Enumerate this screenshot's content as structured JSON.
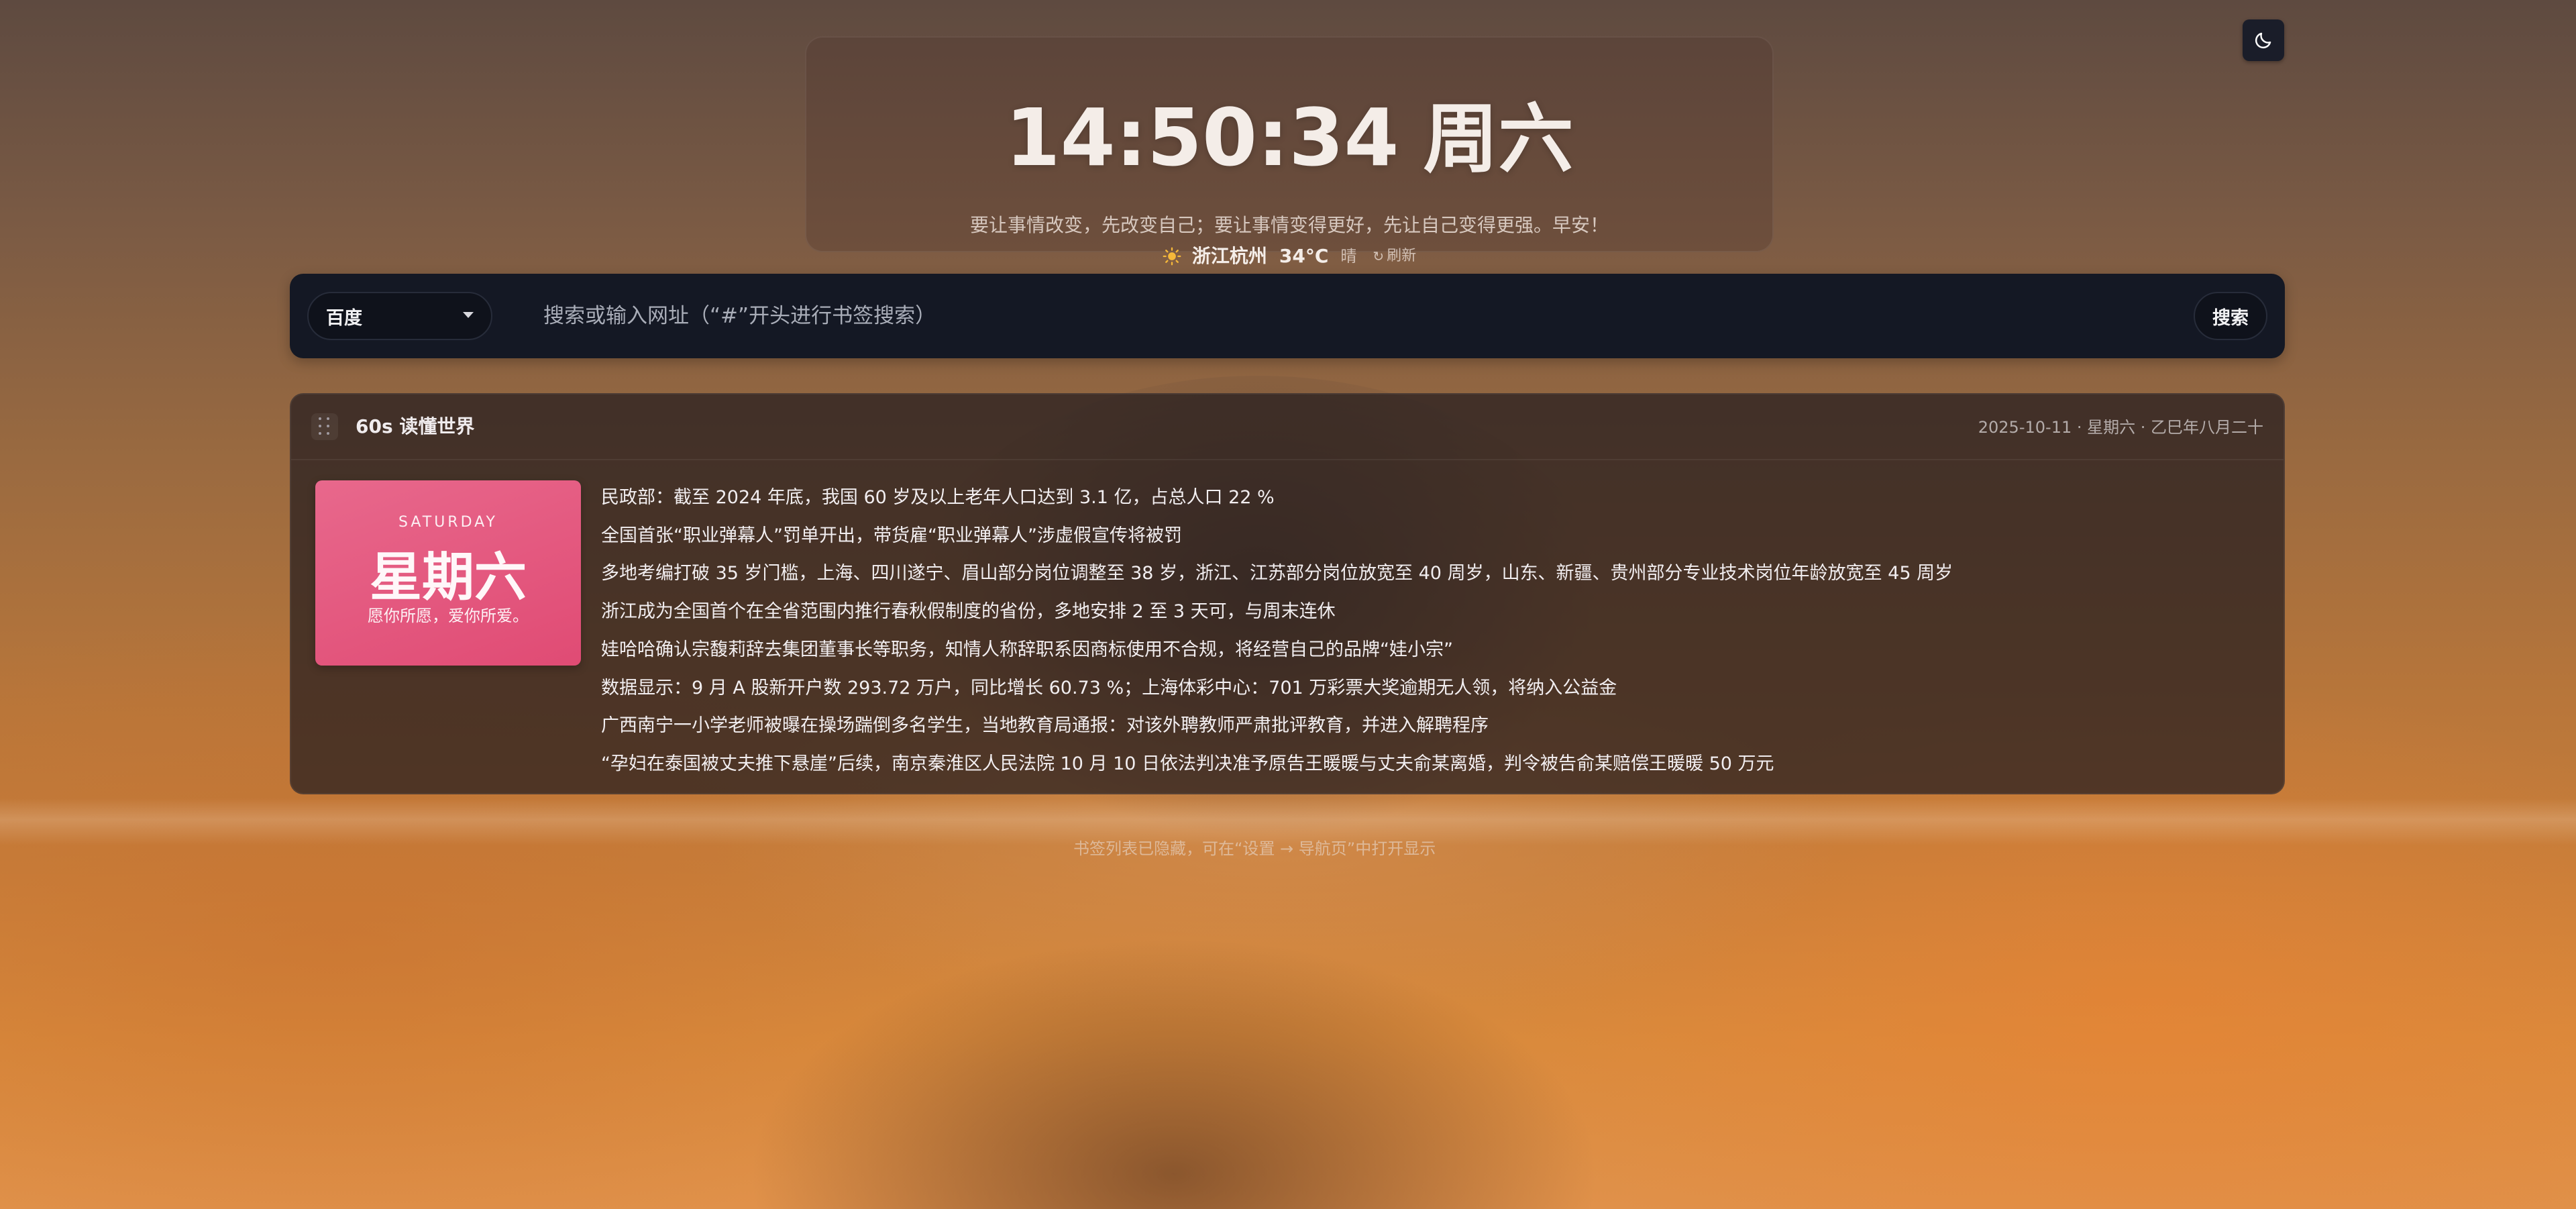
{
  "clock": {
    "time": "14:50:34",
    "weekday": "周六",
    "quote": "要让事情改变，先改变自己；要让事情变得更好，先让自己变得更强。早安！"
  },
  "weather": {
    "icon": "sun-icon",
    "city": "浙江杭州",
    "temperature": "34°C",
    "condition": "晴",
    "refresh_label": "刷新"
  },
  "search": {
    "engine": "百度",
    "placeholder": "搜索或输入网址（“#”开头进行书签搜索）",
    "button_label": "搜索"
  },
  "news_card": {
    "title": "60s 读懂世界",
    "date": "2025-10-11 · 星期六 · 乙巳年八月二十",
    "day_image": {
      "english": "SATURDAY",
      "chinese": "星期六",
      "motto": "愿你所愿，爱你所爱。"
    },
    "items": [
      "民政部：截至 2024 年底，我国 60 岁及以上老年人口达到 3.1 亿，占总人口 22 %",
      "全国首张“职业弹幕人”罚单开出，带货雇“职业弹幕人”涉虚假宣传将被罚",
      "多地考编打破 35 岁门槛，上海、四川遂宁、眉山部分岗位调整至 38 岁，浙江、江苏部分岗位放宽至 40 周岁，山东、新疆、贵州部分专业技术岗位年龄放宽至 45 周岁",
      "浙江成为全国首个在全省范围内推行春秋假制度的省份，多地安排 2 至 3 天可，与周末连休",
      "娃哈哈确认宗馥莉辞去集团董事长等职务，知情人称辞职系因商标使用不合规，将经营自己的品牌“娃小宗”",
      "数据显示：9 月 A 股新开户数 293.72 万户，同比增长 60.73 %；上海体彩中心：701 万彩票大奖逾期无人领，将纳入公益金",
      "广西南宁一小学老师被曝在操场踹倒多名学生，当地教育局通报：对该外聘教师严肃批评教育，并进入解聘程序",
      "“孕妇在泰国被丈夫推下悬崖”后续，南京秦淮区人民法院 10 月 10 日依法判决准予原告王暖暖与丈夫俞某离婚，判令被告俞某赔偿王暖暖 50 万元"
    ]
  },
  "bookmark_hint": "书签列表已隐藏，可在“设置 → 导航页”中打开显示",
  "colors": {
    "panel_dark": "#141824",
    "card_pink": "#e04b74",
    "text_light": "#f4ede8"
  }
}
